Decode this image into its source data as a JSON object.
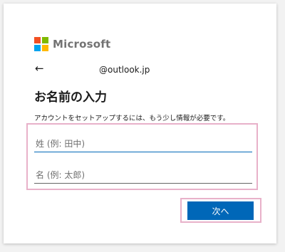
{
  "brand": {
    "name": "Microsoft",
    "colors": [
      "#f25022",
      "#7fba00",
      "#00a4ef",
      "#ffb900"
    ]
  },
  "nav": {
    "back_glyph": "←",
    "identity": "@outlook.jp"
  },
  "page": {
    "title": "お名前の入力",
    "description": "アカウントをセットアップするには、もう少し情報が必要です。"
  },
  "form": {
    "last_name": {
      "placeholder": "姓 (例: 田中)",
      "value": ""
    },
    "first_name": {
      "placeholder": "名 (例: 太郎)",
      "value": ""
    }
  },
  "actions": {
    "next_label": "次へ"
  },
  "colors": {
    "accent": "#0067b8",
    "highlight": "#e8b1c9",
    "background": "#f2f2f2"
  }
}
